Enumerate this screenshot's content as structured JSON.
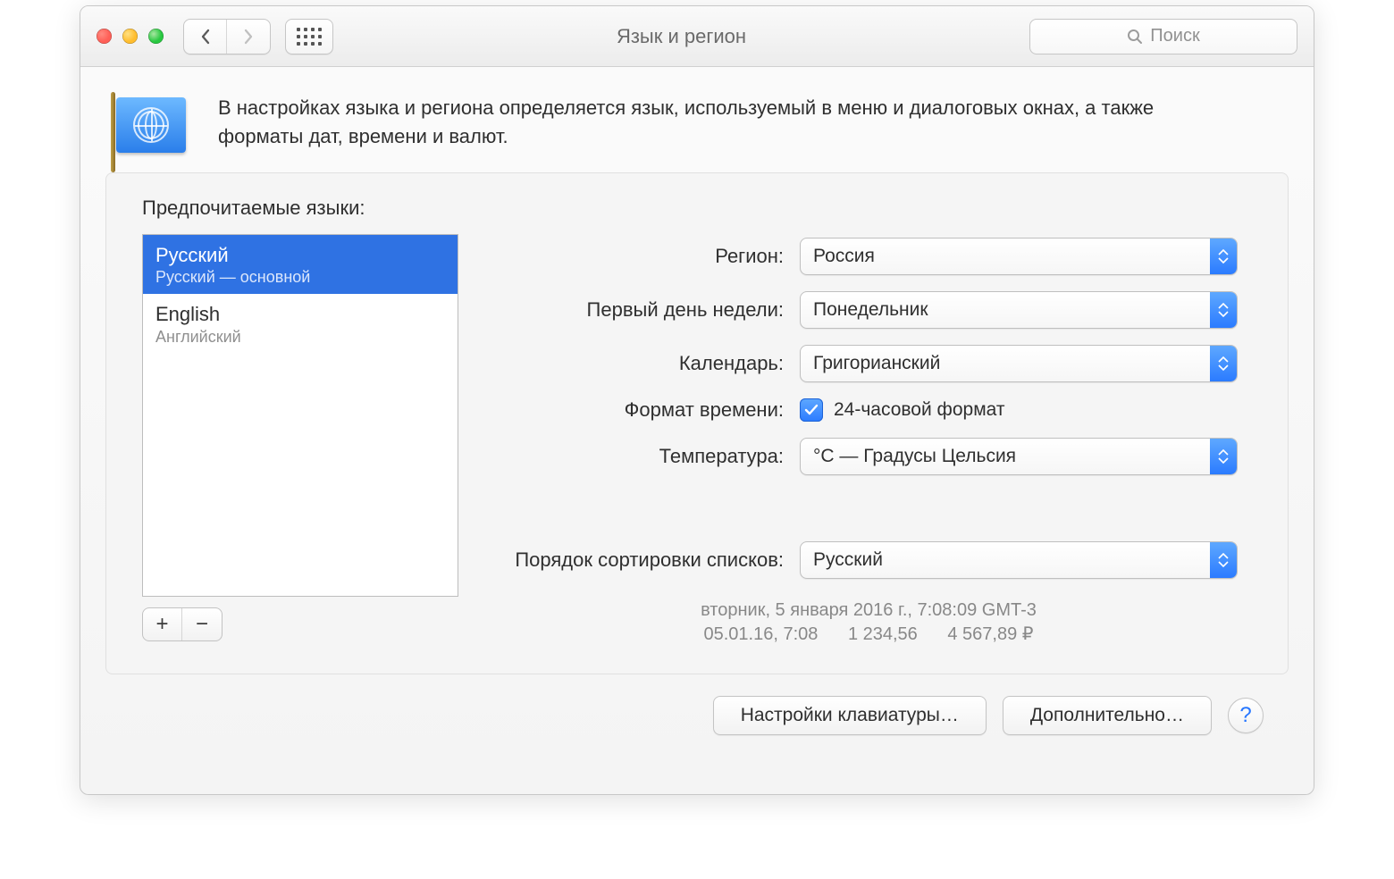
{
  "window": {
    "title": "Язык и регион",
    "search_placeholder": "Поиск"
  },
  "intro": "В настройках языка и региона определяется язык, используемый в меню и диалоговых окнах, а также форматы дат, времени и валют.",
  "panel": {
    "preferred_languages_label": "Предпочитаемые языки:",
    "languages": [
      {
        "name": "Русский",
        "sub": "Русский — основной",
        "selected": true
      },
      {
        "name": "English",
        "sub": "Английский",
        "selected": false
      }
    ],
    "region_label": "Регион:",
    "region_value": "Россия",
    "first_day_label": "Первый день недели:",
    "first_day_value": "Понедельник",
    "calendar_label": "Календарь:",
    "calendar_value": "Григорианский",
    "time_format_label": "Формат времени:",
    "time_format_value": "24-часовой формат",
    "temperature_label": "Температура:",
    "temperature_value": "°C — Градусы Цельсия",
    "sort_order_label": "Порядок сортировки списков:",
    "sort_order_value": "Русский",
    "example_line1": "вторник, 5 января 2016 г., 7:08:09 GMT-3",
    "example_date_short": "05.01.16, 7:08",
    "example_number": "1 234,56",
    "example_currency": "4 567,89 ₽"
  },
  "footer": {
    "keyboard_btn": "Настройки клавиатуры…",
    "advanced_btn": "Дополнительно…",
    "help": "?"
  }
}
